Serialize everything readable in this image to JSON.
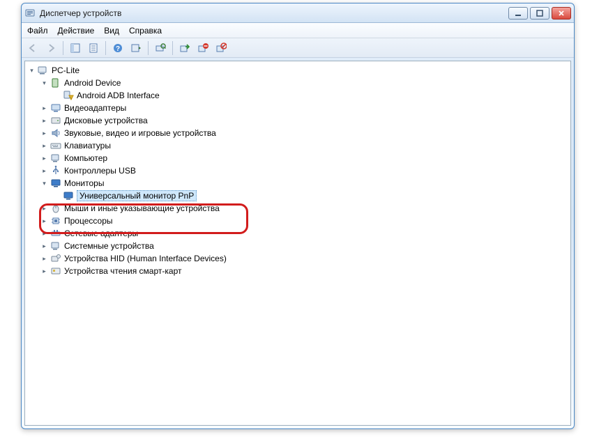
{
  "window": {
    "title": "Диспетчер устройств"
  },
  "menu": {
    "file": "Файл",
    "action": "Действие",
    "view": "Вид",
    "help": "Справка"
  },
  "tree": {
    "root": "PC-Lite",
    "android": {
      "label": "Android Device",
      "adb": "Android ADB Interface"
    },
    "video": "Видеоадаптеры",
    "disk": "Дисковые устройства",
    "audio": "Звуковые, видео и игровые устройства",
    "keyboard": "Клавиатуры",
    "computer": "Компьютер",
    "usb": "Контроллеры USB",
    "monitors": {
      "label": "Мониторы",
      "pnp": "Универсальный монитор PnP"
    },
    "mice": "Мыши и иные указывающие устройства",
    "cpu": "Процессоры",
    "net": "Сетевые адаптеры",
    "system": "Системные устройства",
    "hid": "Устройства HID (Human Interface Devices)",
    "smartcard": "Устройства чтения смарт-карт"
  }
}
